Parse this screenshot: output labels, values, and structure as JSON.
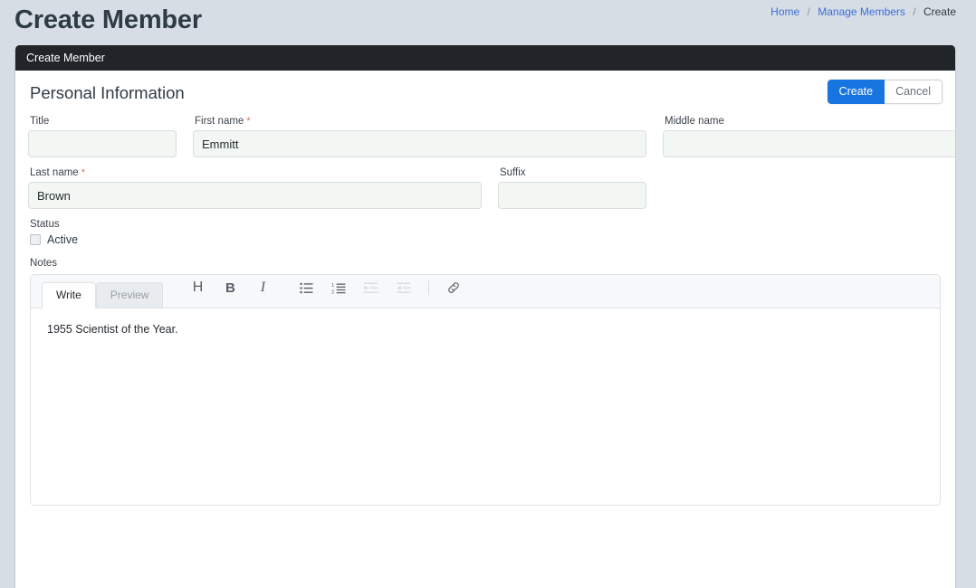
{
  "page": {
    "title": "Create Member",
    "breadcrumb": [
      {
        "label": "Home",
        "link": true
      },
      {
        "label": "Manage Members",
        "link": true
      },
      {
        "label": "Create",
        "link": false
      }
    ],
    "separator": "/"
  },
  "card": {
    "header_title": "Create Member",
    "section_title": "Personal Information",
    "actions": {
      "create_label": "Create",
      "cancel_label": "Cancel"
    }
  },
  "form": {
    "title_field": {
      "label": "Title",
      "value": "",
      "placeholder": "",
      "required": false
    },
    "first_name": {
      "label": "First name",
      "value": "Emmitt",
      "placeholder": "",
      "required": true,
      "required_mark": "*"
    },
    "middle_name": {
      "label": "Middle name",
      "value": "",
      "placeholder": "",
      "required": false
    },
    "last_name": {
      "label": "Last name",
      "value": "Brown",
      "placeholder": "",
      "required": true,
      "required_mark": "*"
    },
    "suffix": {
      "label": "Suffix",
      "value": "",
      "placeholder": "",
      "required": false
    },
    "status": {
      "label": "Status",
      "checkbox_label": "Active",
      "checked": false
    },
    "notes": {
      "label": "Notes"
    }
  },
  "editor": {
    "tabs": [
      {
        "label": "Write",
        "active": true
      },
      {
        "label": "Preview",
        "active": false
      }
    ],
    "tools": [
      {
        "name": "heading-icon",
        "glyph": "H",
        "disabled": false
      },
      {
        "name": "bold-icon",
        "glyph": "B",
        "disabled": false
      },
      {
        "name": "italic-icon",
        "glyph": "I",
        "disabled": false
      },
      {
        "name": "bulleted-list-icon",
        "disabled": false
      },
      {
        "name": "numbered-list-icon",
        "disabled": false
      },
      {
        "name": "indent-icon",
        "disabled": true
      },
      {
        "name": "outdent-icon",
        "disabled": true
      },
      {
        "name": "link-icon",
        "disabled": false
      }
    ],
    "content": "1955 Scientist of the Year."
  },
  "colors": {
    "page_background": "#d6dde5",
    "card_header": "#212529",
    "primary_button": "#1675e0",
    "link": "#3a6fd8",
    "required_asterisk": "#e26a6a",
    "input_background": "#f2f7f3",
    "toolbar_background": "#f6f8fa"
  }
}
